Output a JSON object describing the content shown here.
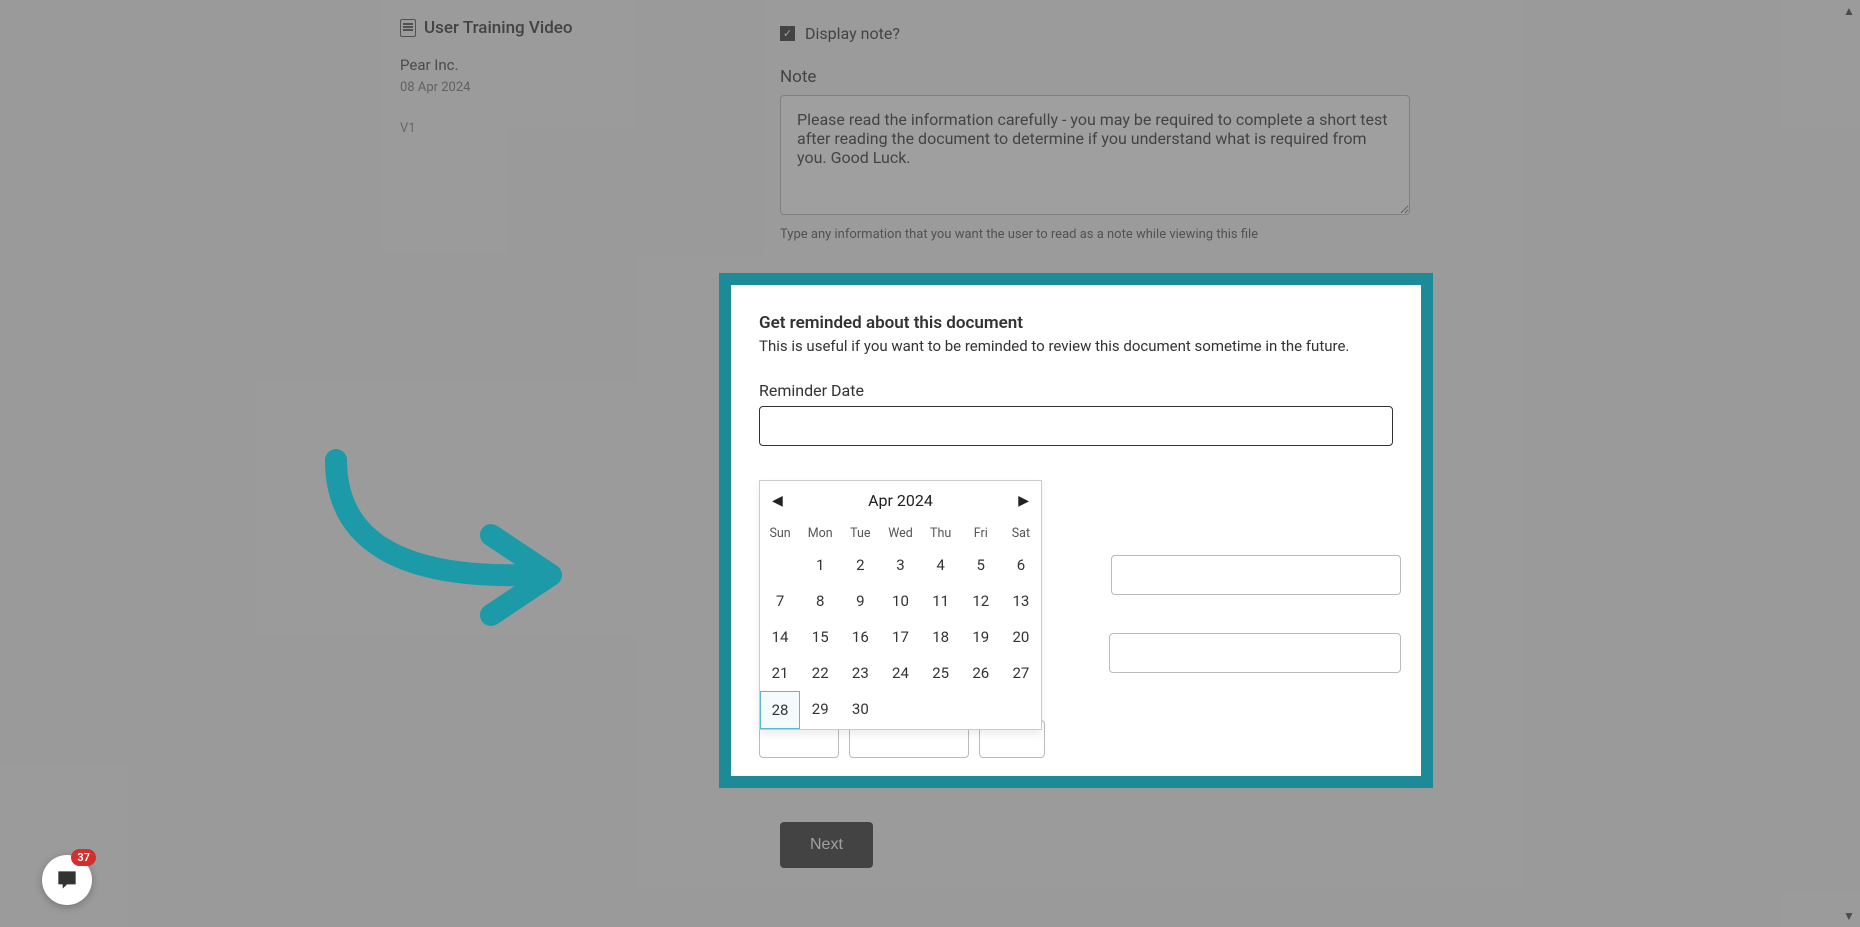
{
  "sidebar": {
    "doc_title": "User Training Video",
    "company": "Pear Inc.",
    "date": "08 Apr 2024",
    "version": "V1"
  },
  "form": {
    "display_note_label": "Display note?",
    "display_note_checked": true,
    "note_label": "Note",
    "note_value": "Please read the information carefully - you may be required to complete a short test after reading the document to determine if you understand what is required from you. Good Luck.",
    "note_help": "Type any information that you want the user to read as a note while viewing this file",
    "next_button": "Next"
  },
  "reminder": {
    "title": "Get reminded about this document",
    "subtitle": "This is useful if you want to be reminded to review this document sometime in the future.",
    "label": "Reminder Date",
    "value": ""
  },
  "datepicker": {
    "month_label": "Apr 2024",
    "dow": [
      "Sun",
      "Mon",
      "Tue",
      "Wed",
      "Thu",
      "Fri",
      "Sat"
    ],
    "leading_blanks": 1,
    "days_in_month": 30,
    "selected_day": 28
  },
  "chat": {
    "badge": "37"
  }
}
